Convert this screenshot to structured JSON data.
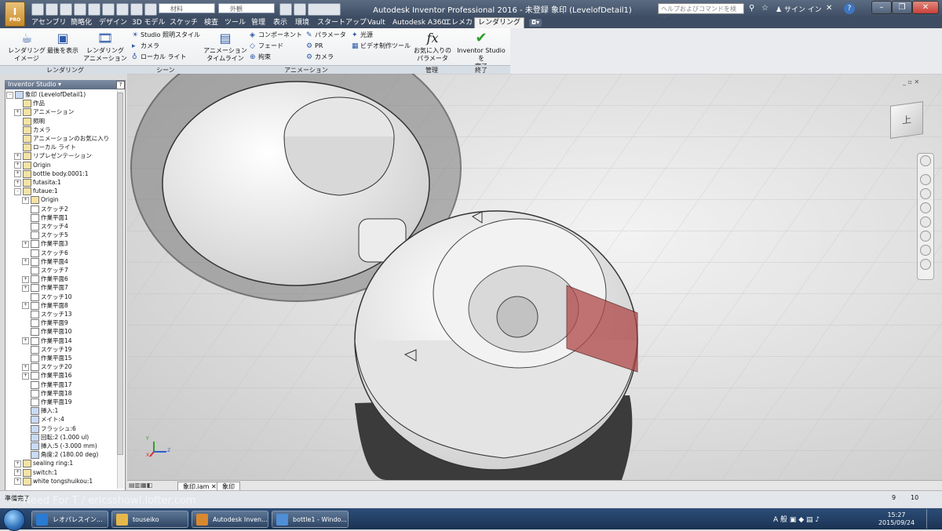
{
  "titlebar": {
    "title": "Autodesk Inventor Professional 2016 - 未登録    象印 (LevelofDetail1)",
    "app_button_label": "I",
    "app_button_sub": "PRO",
    "material_combo": "材料",
    "appearance_combo": "外観",
    "help_search_placeholder": "ヘルプおよびコマンドを検索...",
    "signin_label": "サイン イン"
  },
  "tabs": [
    {
      "label": "アセンブリ"
    },
    {
      "label": "簡略化"
    },
    {
      "label": "デザイン"
    },
    {
      "label": "3D モデル"
    },
    {
      "label": "スケッチ"
    },
    {
      "label": "検査"
    },
    {
      "label": "ツール"
    },
    {
      "label": "管理"
    },
    {
      "label": "表示"
    },
    {
      "label": "環境"
    },
    {
      "label": "スタートアップ"
    },
    {
      "label": "Vault"
    },
    {
      "label": "Autodesk A360"
    },
    {
      "label": "エレメカ"
    },
    {
      "label": "レンダリング",
      "active": true
    }
  ],
  "ribbon": {
    "render_image": "レンダリング\nイメージ",
    "show_last": "最後を表示",
    "render_animation": "レンダリング\nアニメーション",
    "studio_lighting": "Studio 照明スタイル",
    "camera": "カメラ",
    "local_light": "ローカル ライト",
    "animation_timeline": "アニメーション\nタイムライン",
    "component": "コンポーネント",
    "fade": "フェード",
    "constraint": "拘束",
    "parameter": "パラメータ",
    "pr": "PR",
    "camera2": "カメラ",
    "light": "光源",
    "video_producer": "ビデオ制作ツール",
    "favorite_params": "お気に入りの\nパラメータ",
    "finish_studio": "Inventor Studio を\n完了",
    "panels": {
      "render": "レンダリング",
      "scene": "シーン",
      "animation": "アニメーション",
      "manage": "管理",
      "exit": "終了"
    }
  },
  "browser": {
    "title": "Inventor Studio ▾",
    "tree": [
      {
        "label": "象印 (LevelofDetail1)",
        "indent": 0,
        "pm": "-",
        "icon": "blue"
      },
      {
        "label": "作品",
        "indent": 1,
        "pm": "",
        "icon": "yellow"
      },
      {
        "label": "アニメーション",
        "indent": 1,
        "pm": "+",
        "icon": "yellow"
      },
      {
        "label": "照明",
        "indent": 1,
        "pm": "",
        "icon": "yellow"
      },
      {
        "label": "カメラ",
        "indent": 1,
        "pm": "",
        "icon": "yellow"
      },
      {
        "label": "アニメーションのお気に入り",
        "indent": 1,
        "pm": "",
        "icon": "yellow"
      },
      {
        "label": "ローカル ライト",
        "indent": 1,
        "pm": "",
        "icon": "yellow"
      },
      {
        "label": "リプレゼンテーション",
        "indent": 1,
        "pm": "+",
        "icon": "yellow"
      },
      {
        "label": "Origin",
        "indent": 1,
        "pm": "+",
        "icon": "yellow"
      },
      {
        "label": "bottle body.0001:1",
        "indent": 1,
        "pm": "+",
        "icon": "yellow"
      },
      {
        "label": "futasita:1",
        "indent": 1,
        "pm": "+",
        "icon": "yellow"
      },
      {
        "label": "futaue:1",
        "indent": 1,
        "pm": "-",
        "icon": "yellow"
      },
      {
        "label": "Origin",
        "indent": 2,
        "pm": "+",
        "icon": "yellow"
      },
      {
        "label": "スケッチ2",
        "indent": 2,
        "pm": "",
        "icon": "sk"
      },
      {
        "label": "作業平面1",
        "indent": 2,
        "pm": "",
        "icon": "sk"
      },
      {
        "label": "スケッチ4",
        "indent": 2,
        "pm": "",
        "icon": "sk"
      },
      {
        "label": "スケッチ5",
        "indent": 2,
        "pm": "",
        "icon": "sk"
      },
      {
        "label": "作業平面3",
        "indent": 2,
        "pm": "+",
        "icon": "sk"
      },
      {
        "label": "スケッチ6",
        "indent": 2,
        "pm": "",
        "icon": "sk"
      },
      {
        "label": "作業平面4",
        "indent": 2,
        "pm": "+",
        "icon": "sk"
      },
      {
        "label": "スケッチ7",
        "indent": 2,
        "pm": "",
        "icon": "sk"
      },
      {
        "label": "作業平面6",
        "indent": 2,
        "pm": "+",
        "icon": "sk"
      },
      {
        "label": "作業平面7",
        "indent": 2,
        "pm": "+",
        "icon": "sk"
      },
      {
        "label": "スケッチ10",
        "indent": 2,
        "pm": "",
        "icon": "sk"
      },
      {
        "label": "作業平面8",
        "indent": 2,
        "pm": "+",
        "icon": "sk"
      },
      {
        "label": "スケッチ13",
        "indent": 2,
        "pm": "",
        "icon": "sk"
      },
      {
        "label": "作業平面9",
        "indent": 2,
        "pm": "",
        "icon": "sk"
      },
      {
        "label": "作業平面10",
        "indent": 2,
        "pm": "",
        "icon": "sk"
      },
      {
        "label": "作業平面14",
        "indent": 2,
        "pm": "+",
        "icon": "sk"
      },
      {
        "label": "スケッチ19",
        "indent": 2,
        "pm": "",
        "icon": "sk"
      },
      {
        "label": "作業平面15",
        "indent": 2,
        "pm": "",
        "icon": "sk"
      },
      {
        "label": "スケッチ20",
        "indent": 2,
        "pm": "+",
        "icon": "sk"
      },
      {
        "label": "作業平面16",
        "indent": 2,
        "pm": "+",
        "icon": "sk"
      },
      {
        "label": "作業平面17",
        "indent": 2,
        "pm": "",
        "icon": "sk"
      },
      {
        "label": "作業平面18",
        "indent": 2,
        "pm": "",
        "icon": "sk"
      },
      {
        "label": "作業平面19",
        "indent": 2,
        "pm": "",
        "icon": "sk"
      },
      {
        "label": "挿入:1",
        "indent": 2,
        "pm": "",
        "icon": "blue"
      },
      {
        "label": "メイト:4",
        "indent": 2,
        "pm": "",
        "icon": "blue"
      },
      {
        "label": "フラッシュ:6",
        "indent": 2,
        "pm": "",
        "icon": "blue"
      },
      {
        "label": "回転:2 (1.000 ul)",
        "indent": 2,
        "pm": "",
        "icon": "blue"
      },
      {
        "label": "挿入:5 (-3.000 mm)",
        "indent": 2,
        "pm": "",
        "icon": "blue"
      },
      {
        "label": "角度:2 (180.00 deg)",
        "indent": 2,
        "pm": "",
        "icon": "blue"
      },
      {
        "label": "sealing  ring:1",
        "indent": 1,
        "pm": "+",
        "icon": "yellow"
      },
      {
        "label": "switch:1",
        "indent": 1,
        "pm": "+",
        "icon": "yellow"
      },
      {
        "label": "white tongshuikou:1",
        "indent": 1,
        "pm": "+",
        "icon": "yellow"
      }
    ]
  },
  "doc_tabs": [
    {
      "label": "象印.iam"
    },
    {
      "label": "象印"
    }
  ],
  "viewcube_face": "上",
  "triad": {
    "x": "X",
    "y": "Y",
    "z": "Z"
  },
  "status": {
    "text": "準備完了",
    "count1": "9",
    "count2": "10"
  },
  "watermark": "© Need For T / ericsshowl.lofter.com",
  "taskbar": {
    "items": [
      {
        "label": "レオパレスイン...",
        "color": "#2a7bd2"
      },
      {
        "label": "touseiko",
        "color": "#e6b84a"
      },
      {
        "label": "Autodesk Inven...",
        "color": "#d8892f"
      },
      {
        "label": "bottle1 - Windo...",
        "color": "#4e8fd6"
      }
    ],
    "time": "15:27",
    "date": "2015/09/24",
    "ime": "A 般"
  },
  "colors": {
    "accent": "#2d5aa8",
    "ribbon_bg": "#eef0f2",
    "titlebar": "#4a5a70",
    "taskbar": "#1f3a60",
    "close_button": "#c9403a",
    "finish_check": "#2aa02a"
  }
}
